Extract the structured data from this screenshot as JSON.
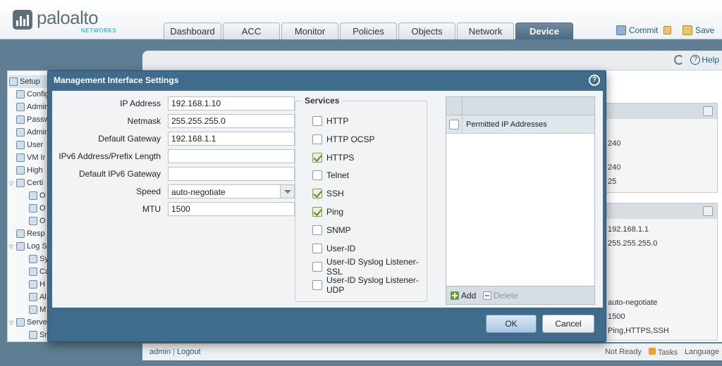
{
  "header": {
    "logo_word": "paloalto",
    "logo_sub": "NETWORKS",
    "tabs": [
      {
        "label": "Dashboard",
        "active": false
      },
      {
        "label": "ACC",
        "active": false
      },
      {
        "label": "Monitor",
        "active": false
      },
      {
        "label": "Policies",
        "active": false
      },
      {
        "label": "Objects",
        "active": false
      },
      {
        "label": "Network",
        "active": false
      },
      {
        "label": "Device",
        "active": true
      }
    ],
    "commit_label": "Commit",
    "save_label": "Save"
  },
  "toolbar": {
    "help_label": "Help"
  },
  "sidebar": {
    "items": [
      {
        "label": "Setup",
        "toggle": ""
      },
      {
        "label": "Config",
        "toggle": ""
      },
      {
        "label": "Admin",
        "toggle": ""
      },
      {
        "label": "Passw",
        "toggle": ""
      },
      {
        "label": "Admin",
        "toggle": ""
      },
      {
        "label": "User",
        "toggle": ""
      },
      {
        "label": "VM Ir",
        "toggle": ""
      },
      {
        "label": "High",
        "toggle": ""
      },
      {
        "label": "Certi",
        "toggle": "▽"
      },
      {
        "label": "O",
        "toggle": ""
      },
      {
        "label": "O",
        "toggle": ""
      },
      {
        "label": "O",
        "toggle": ""
      },
      {
        "label": "Resp",
        "toggle": ""
      },
      {
        "label": "Log S",
        "toggle": "▽"
      },
      {
        "label": "Sy",
        "toggle": ""
      },
      {
        "label": "Ca",
        "toggle": ""
      },
      {
        "label": "H",
        "toggle": ""
      },
      {
        "label": "Al",
        "toggle": ""
      },
      {
        "label": "M",
        "toggle": ""
      },
      {
        "label": "Serve",
        "toggle": "▽"
      },
      {
        "label": "Sr",
        "toggle": ""
      }
    ]
  },
  "background_panel": {
    "values_top": [
      "240",
      "240",
      "25"
    ],
    "values_bottom": [
      "192.168.1.1",
      "255.255.255.0",
      "auto-negotiate",
      "1500",
      "Ping,HTTPS,SSH"
    ]
  },
  "footer": {
    "admin": "admin",
    "logout": "Logout",
    "status": "Not Ready",
    "tasks": "Tasks",
    "language": "Language"
  },
  "dialog": {
    "title": "Management Interface Settings",
    "help": "?",
    "fields": {
      "ip_label": "IP Address",
      "ip_value": "192.168.1.10",
      "netmask_label": "Netmask",
      "netmask_value": "255.255.255.0",
      "gateway_label": "Default Gateway",
      "gateway_value": "192.168.1.1",
      "ipv6_label": "IPv6 Address/Prefix Length",
      "ipv6_value": "",
      "ipv6gw_label": "Default IPv6 Gateway",
      "ipv6gw_value": "",
      "speed_label": "Speed",
      "speed_value": "auto-negotiate",
      "mtu_label": "MTU",
      "mtu_value": "1500"
    },
    "services_title": "Services",
    "services": [
      {
        "label": "HTTP",
        "checked": false
      },
      {
        "label": "HTTP OCSP",
        "checked": false
      },
      {
        "label": "HTTPS",
        "checked": true
      },
      {
        "label": "Telnet",
        "checked": false
      },
      {
        "label": "SSH",
        "checked": true
      },
      {
        "label": "Ping",
        "checked": true
      },
      {
        "label": "SNMP",
        "checked": false
      },
      {
        "label": "User-ID",
        "checked": false
      },
      {
        "label": "User-ID Syslog Listener-SSL",
        "checked": false
      },
      {
        "label": "User-ID Syslog Listener-UDP",
        "checked": false
      }
    ],
    "permitted_header": "Permitted IP Addresses",
    "add_label": "Add",
    "delete_label": "Delete",
    "ok_label": "OK",
    "cancel_label": "Cancel"
  }
}
